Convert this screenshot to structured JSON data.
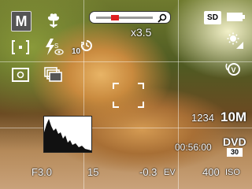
{
  "camera": {
    "mode": "M",
    "zoom": {
      "label": "x3.5",
      "level": 0.3
    },
    "self_timer": "10",
    "storage": "SD",
    "image_size": {
      "count": "1234",
      "size": "10M"
    },
    "recording_time": "00:56:00",
    "video_format": "DVD",
    "frame_rate": "30",
    "aperture": "F3.0",
    "shutter": "15",
    "exposure": {
      "value": "-0.3",
      "unit": "EV"
    },
    "iso": {
      "value": "400",
      "unit": "ISO"
    }
  },
  "icons": {
    "scene": "macro-flower-icon",
    "metering": "spot-metering-icon",
    "flash": "flash-redeye-icon",
    "timer": "self-timer-icon",
    "af": "af-frame-icon",
    "drive": "continuous-shooting-icon",
    "wb": "white-balance-icon",
    "stabilizer": "stabilizer-icon",
    "zoom": "zoom-magnifier-icon",
    "battery": "battery-full-icon"
  }
}
